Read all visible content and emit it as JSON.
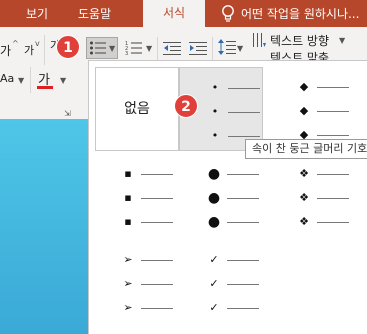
{
  "tabs": {
    "view": "보기",
    "help": "도움말",
    "format": "서식",
    "tell_me": "어떤 작업을 원하시나..."
  },
  "ribbon": {
    "font_size_up": "가",
    "font_size_down": "가",
    "clear_format": "가",
    "change_case": "Aa",
    "font_color_label": "가",
    "text_direction": "텍스트 방향",
    "align_text": "텍스트 맞춤"
  },
  "bullets": {
    "none_label": "없음",
    "tooltip": "속이 찬 둥근 글머리 기호"
  },
  "badges": {
    "step1": "1",
    "step2": "2"
  },
  "colors": {
    "accent": "#b7472a",
    "badge": "#e0403a",
    "font_color_bar": "#e02020"
  }
}
